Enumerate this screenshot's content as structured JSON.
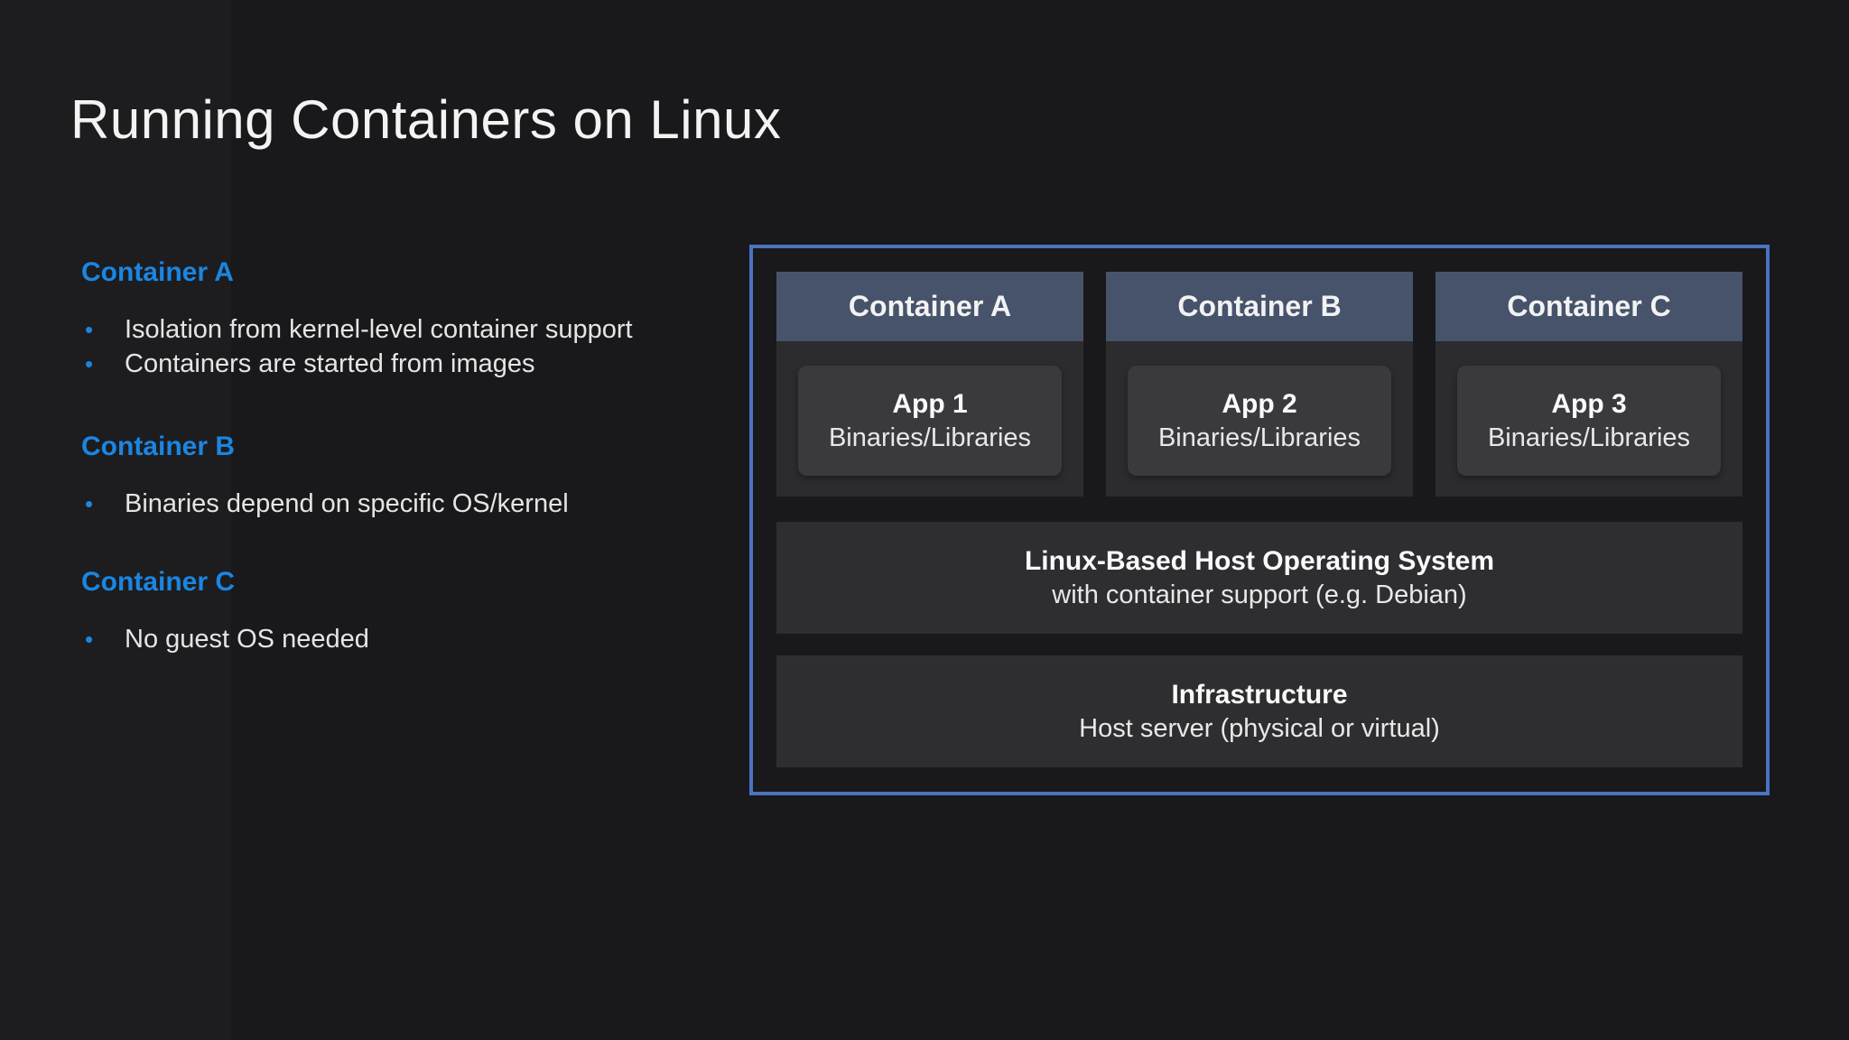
{
  "title": "Running Containers on Linux",
  "bullet_glyph": "•",
  "notes": [
    {
      "heading": "Container A",
      "bullets": [
        "Isolation from kernel-level container support",
        "Containers are started from images"
      ]
    },
    {
      "heading": "Container B",
      "bullets": [
        "Binaries depend on specific OS/kernel"
      ]
    },
    {
      "heading": "Container C",
      "bullets": [
        "No guest OS needed"
      ]
    }
  ],
  "diagram": {
    "containers": [
      {
        "name": "Container A",
        "app": "App 1",
        "sub": "Binaries/Libraries"
      },
      {
        "name": "Container B",
        "app": "App 2",
        "sub": "Binaries/Libraries"
      },
      {
        "name": "Container C",
        "app": "App 3",
        "sub": "Binaries/Libraries"
      }
    ],
    "layers": [
      {
        "title": "Linux-Based Host Operating System",
        "subtitle": "with container support (e.g. Debian)"
      },
      {
        "title": "Infrastructure",
        "subtitle": "Host server (physical or virtual)"
      }
    ]
  },
  "colors": {
    "accent_blue": "#1a86e3",
    "border_blue": "#4a73c0",
    "header_slate": "#46536b",
    "panel_gray": "#2e2e31",
    "app_box_gray": "#3a3a3e",
    "background": "#19181a"
  }
}
